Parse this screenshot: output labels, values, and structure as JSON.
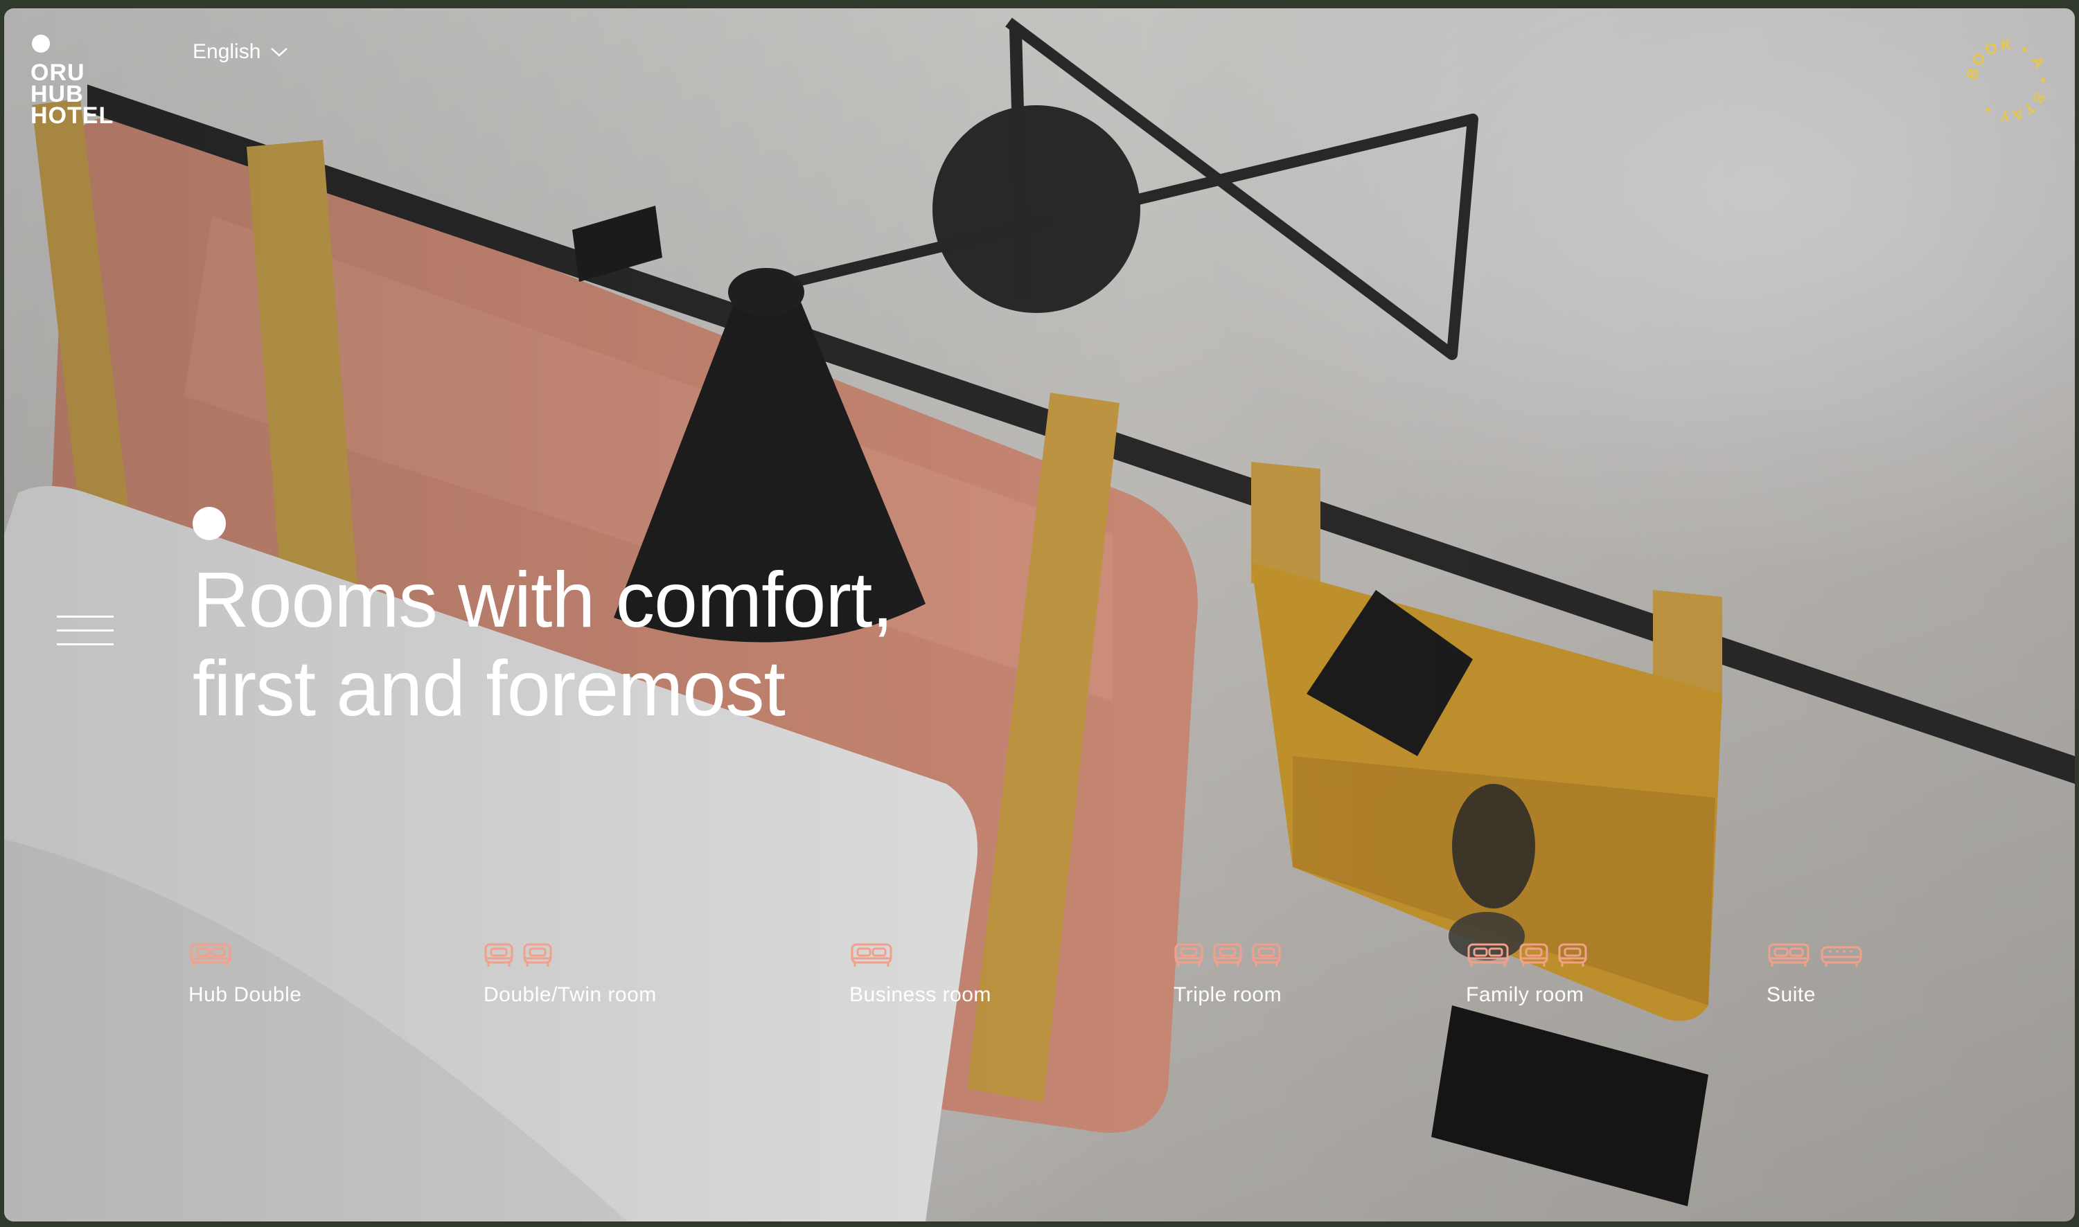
{
  "brand": {
    "logo_text": "ORU\nHUB\nHOTEL"
  },
  "header": {
    "language": "English",
    "book_badge": "BOOK • A • STAY •"
  },
  "hero": {
    "line1": "Rooms with comfort,",
    "line2": "first and foremost"
  },
  "rooms": [
    {
      "label": "Hub Double",
      "icons": [
        "double-bed-icon"
      ]
    },
    {
      "label": "Double/Twin room",
      "icons": [
        "single-bed-icon",
        "single-bed-icon"
      ]
    },
    {
      "label": "Business room",
      "icons": [
        "double-bed-icon"
      ]
    },
    {
      "label": "Triple room",
      "icons": [
        "single-bed-icon",
        "single-bed-icon",
        "single-bed-icon"
      ]
    },
    {
      "label": "Family room",
      "icons": [
        "double-bed-icon",
        "single-bed-icon",
        "single-bed-icon"
      ]
    },
    {
      "label": "Suite",
      "icons": [
        "double-bed-icon",
        "sofa-icon"
      ]
    }
  ],
  "colors": {
    "accent_yellow": "#e8c64a",
    "icon_salmon": "#f2a08a",
    "frame": "#2f3a2d"
  }
}
